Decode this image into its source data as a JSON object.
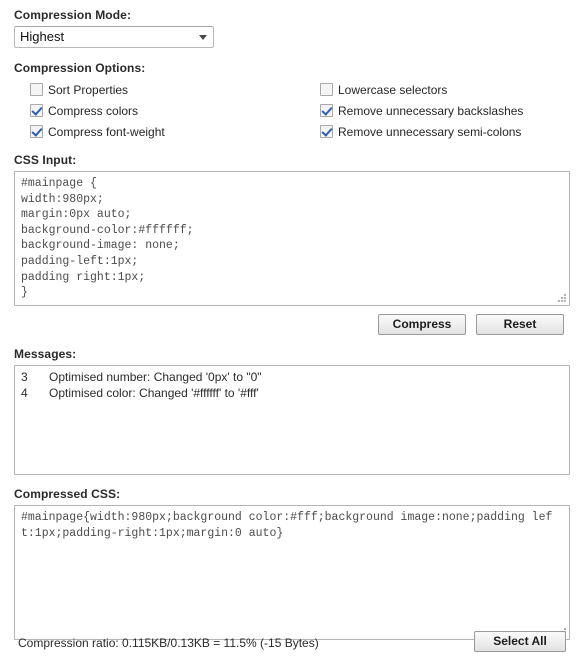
{
  "compression_mode": {
    "label": "Compression Mode:",
    "selected": "Highest",
    "dropdown_icon": "chevron-down-icon"
  },
  "compression_options": {
    "label": "Compression Options:",
    "left_column": [
      {
        "label": "Sort Properties",
        "checked": false
      },
      {
        "label": "Compress colors",
        "checked": true
      },
      {
        "label": "Compress font-weight",
        "checked": true
      }
    ],
    "right_column": [
      {
        "label": "Lowercase selectors",
        "checked": false
      },
      {
        "label": "Remove unnecessary backslashes",
        "checked": true
      },
      {
        "label": "Remove unnecessary semi-colons",
        "checked": true
      }
    ]
  },
  "css_input": {
    "label": "CSS Input:",
    "value": "#mainpage {\nwidth:980px;\nmargin:0px auto;\nbackground-color:#ffffff;\nbackground-image: none;\npadding-left:1px;\npadding right:1px;\n}",
    "resize_grip": "resize-grip-icon"
  },
  "actions": {
    "compress_label": "Compress",
    "reset_label": "Reset"
  },
  "messages": {
    "label": "Messages:",
    "rows": [
      {
        "num": "3",
        "text": "Optimised number: Changed '0px' to \"0\""
      },
      {
        "num": "4",
        "text": "Optimised color: Changed '#ffffff' to '#fff'"
      }
    ]
  },
  "compressed_css": {
    "label": "Compressed CSS:",
    "value": "#mainpage{width:980px;background color:#fff;background image:none;padding left:1px;padding-right:1px;margin:0 auto}",
    "resize_grip": "resize-grip-icon"
  },
  "footer": {
    "ratio_text": "Compression ratio: 0.115KB/0.13KB = 11.5% (-15 Bytes)",
    "select_all_label": "Select All"
  }
}
